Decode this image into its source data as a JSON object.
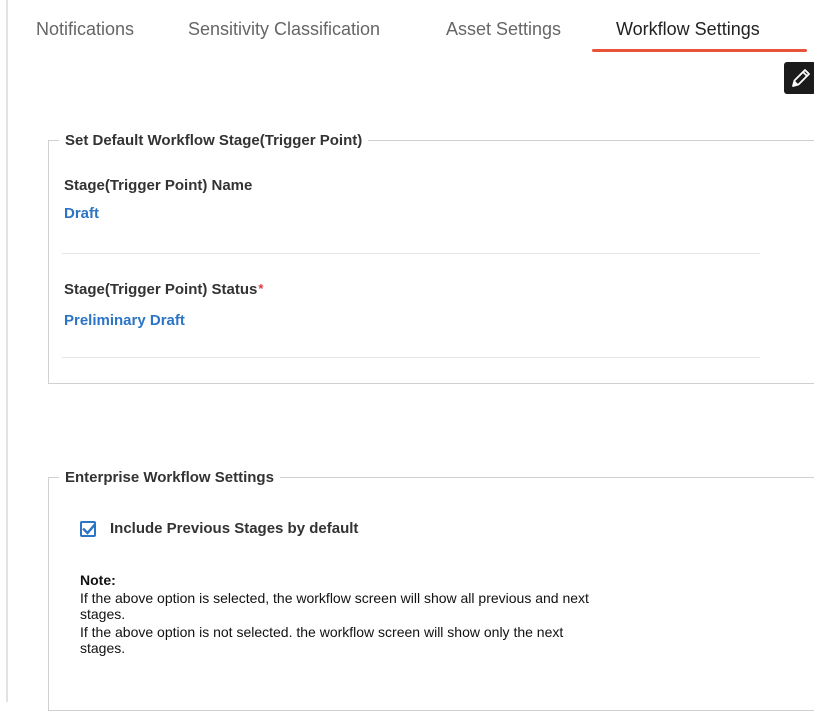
{
  "tabs": [
    {
      "label": "Notifications",
      "active": false
    },
    {
      "label": "Sensitivity Classification",
      "active": false
    },
    {
      "label": "Asset Settings",
      "active": false
    },
    {
      "label": "Workflow Settings",
      "active": true
    }
  ],
  "toolbar": {
    "edit_icon": "pencil-icon",
    "edit_button_color": "#1b1b1b"
  },
  "default_stage": {
    "legend": "Set Default Workflow Stage(Trigger Point)",
    "name_label": "Stage(Trigger Point) Name",
    "name_value": "Draft",
    "status_label": "Stage(Trigger Point) Status",
    "status_required_mark": "*",
    "status_value": "Preliminary Draft"
  },
  "enterprise": {
    "legend": "Enterprise Workflow Settings",
    "include_previous_label": "Include Previous Stages by default",
    "include_previous_checked": true,
    "note_title": "Note:",
    "note_lines": [
      "If the above option is selected, the workflow screen will show all previous and next",
      "stages.",
      "If the above option is not selected. the workflow screen will show only the next",
      "stages."
    ]
  },
  "colors": {
    "accent": "#e8533a",
    "link": "#2b74c6",
    "required": "#e0383e"
  }
}
